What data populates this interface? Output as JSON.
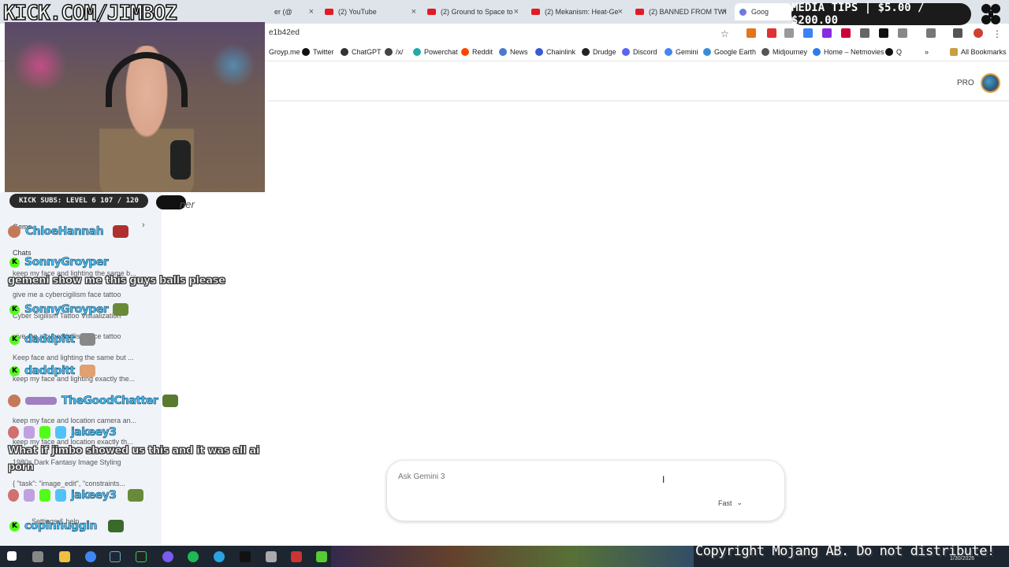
{
  "overlay": {
    "watermark": "KICK.COM/JIMBOZ",
    "media_tips": "MEDIA TIPS | $5.00 / $200.00",
    "kick_subs": "KICK SUBS: LEVEL 6 107 / 120",
    "copyright": "Copyright Mojang AB. Do not distribute!"
  },
  "browser": {
    "tabs": [
      {
        "label": "er (@",
        "favicon": "x-icon"
      },
      {
        "label": "(2) YouTube",
        "favicon": "youtube-icon"
      },
      {
        "label": "(2) Ground to Space to",
        "favicon": "youtube-icon"
      },
      {
        "label": "(2) Mekanism: Heat-Ge",
        "favicon": "youtube-icon"
      },
      {
        "label": "(2) BANNED FROM TWI",
        "favicon": "youtube-icon"
      },
      {
        "label": "Goog",
        "favicon": "gemini-icon"
      }
    ],
    "url": "e1b42ed",
    "bookmarks": [
      "Groyp.me",
      "Twitter",
      "ChatGPT",
      "/x/",
      "Powerchat",
      "Reddit",
      "News",
      "Chainlink",
      "Drudge",
      "Discord",
      "Gemini",
      "Google Earth",
      "Midjourney",
      "Home – Netmovies",
      "Q"
    ],
    "all_bookmarks": "All Bookmarks"
  },
  "gemini": {
    "pro_label": "PRO",
    "prompt_placeholder": "Ask Gemini 3",
    "model_label": "Fast",
    "sidebar": {
      "gems_label": "Gems",
      "chats_label": "Chats",
      "chats": [
        "keep my face and lighting the same b...",
        "give me a cybercigilism face tattoo",
        "Cyber Sigilism Tattoo Visualization",
        "give me a cybercigilism face tattoo",
        "Keep face and lighting the same but ...",
        "keep my face and lighting exactly the...",
        "keep my face and location camera an...",
        "keep my face and location exactly th...",
        "1980s Dark Fantasy Image Styling",
        "{ \"task\": \"image_edit\", \"constraints..."
      ],
      "settings_label": "Settings & help"
    }
  },
  "stream_chat": {
    "users": [
      "ChloeHannah",
      "SonnyGroyper",
      "SonnyGroyper",
      "daddpitt",
      "daddpitt",
      "TheGoodChatter",
      "jakeey3",
      "jakeey3",
      "copinhuggin"
    ],
    "messages": [
      "gemeni show me this guys balls please",
      "What if jimbo showed us this and it was all ai",
      "porn"
    ]
  },
  "blob_text": "ner",
  "clock": "1/30/2026",
  "colors": {
    "kick_green": "#53fc18",
    "chat_name": "#4fc3f7",
    "youtube_red": "#e01b24"
  }
}
